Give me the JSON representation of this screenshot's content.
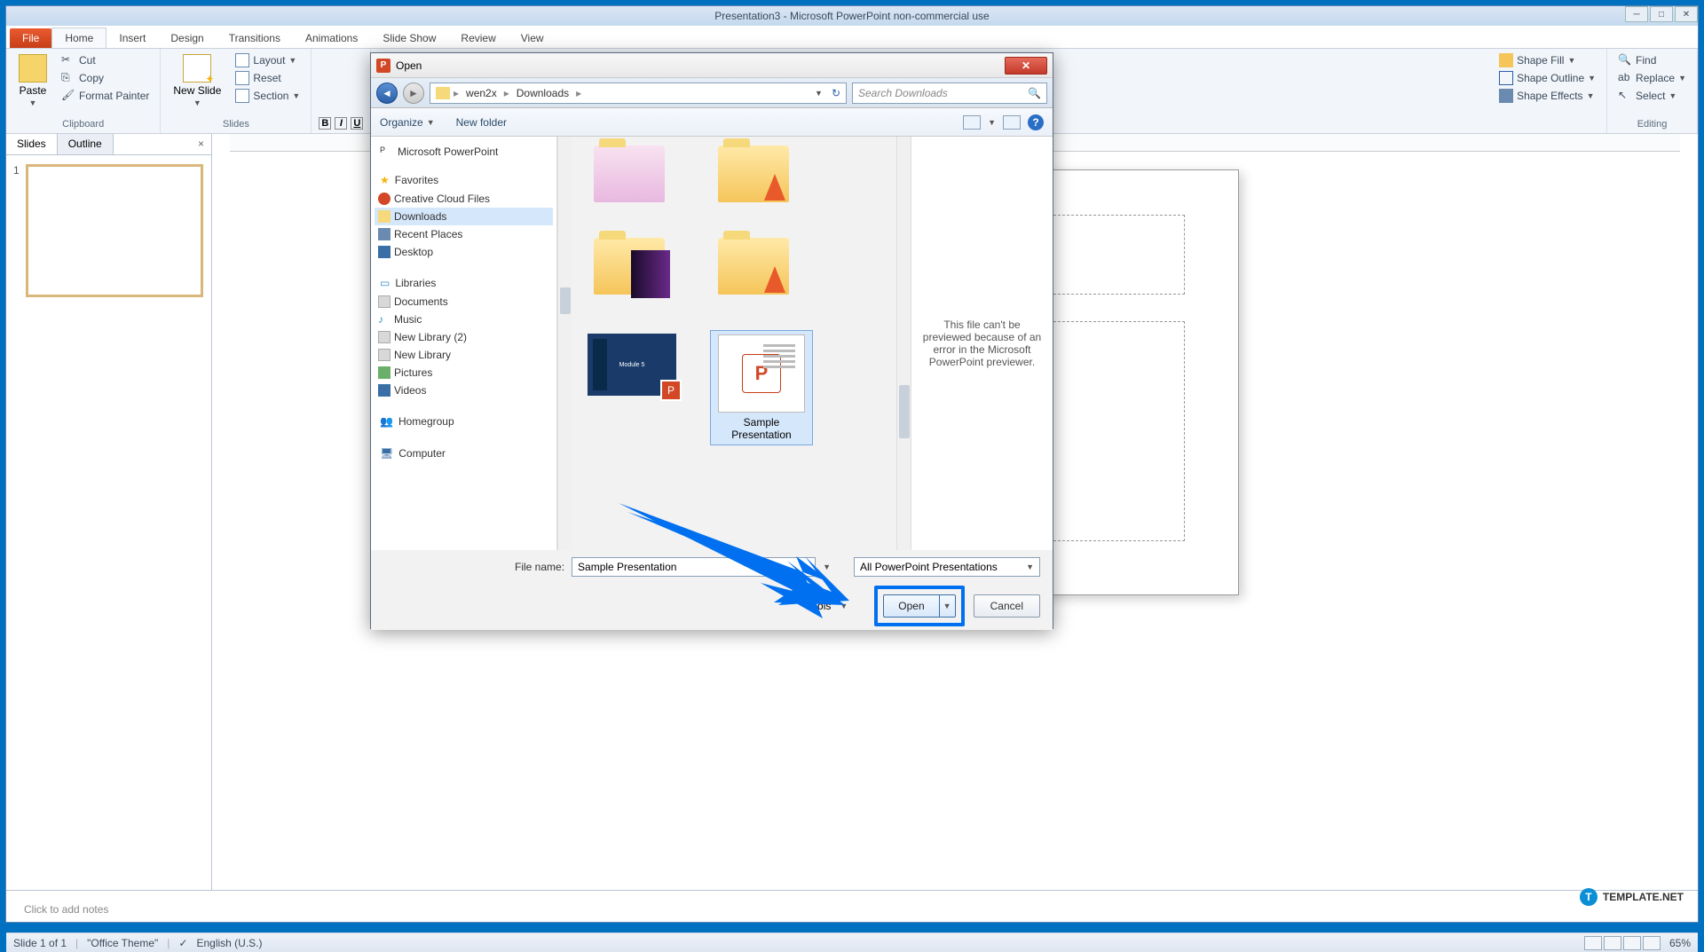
{
  "window": {
    "title": "Presentation3 - Microsoft PowerPoint non-commercial use"
  },
  "tabs": {
    "file": "File",
    "home": "Home",
    "insert": "Insert",
    "design": "Design",
    "transitions": "Transitions",
    "animations": "Animations",
    "slideshow": "Slide Show",
    "review": "Review",
    "view": "View"
  },
  "ribbon": {
    "clipboard": {
      "paste": "Paste",
      "cut": "Cut",
      "copy": "Copy",
      "format_painter": "Format Painter",
      "label": "Clipboard"
    },
    "slides": {
      "new_slide": "New Slide",
      "layout": "Layout",
      "reset": "Reset",
      "section": "Section",
      "label": "Slides"
    },
    "drawing": {
      "shape_fill": "Shape Fill",
      "shape_outline": "Shape Outline",
      "shape_effects": "Shape Effects"
    },
    "editing": {
      "find": "Find",
      "replace": "Replace",
      "select": "Select",
      "label": "Editing"
    }
  },
  "slide_panel": {
    "tab_slides": "Slides",
    "tab_outline": "Outline",
    "thumb_number": "1"
  },
  "notes": {
    "placeholder": "Click to add notes"
  },
  "status": {
    "slide_info": "Slide 1 of 1",
    "theme": "\"Office Theme\"",
    "lang": "English (U.S.)",
    "zoom": "65%"
  },
  "dialog": {
    "title": "Open",
    "breadcrumb": [
      "wen2x",
      "Downloads"
    ],
    "search_placeholder": "Search Downloads",
    "organize": "Organize",
    "new_folder": "New folder",
    "tree": {
      "app_folder": "Microsoft PowerPoint",
      "favorites": "Favorites",
      "fav_items": [
        "Creative Cloud Files",
        "Downloads",
        "Recent Places",
        "Desktop"
      ],
      "libraries": "Libraries",
      "lib_items": [
        "Documents",
        "Music",
        "New Library (2)",
        "New Library",
        "Pictures",
        "Videos"
      ],
      "homegroup": "Homegroup",
      "computer": "Computer"
    },
    "files": {
      "sample_name": "Sample Presentation"
    },
    "preview_msg": "This file can't be previewed because of an error in the Microsoft PowerPoint previewer.",
    "file_name_label": "File name:",
    "file_name_value": "Sample Presentation",
    "file_type": "All PowerPoint Presentations",
    "tools": "Tools",
    "open": "Open",
    "cancel": "Cancel"
  },
  "watermark": {
    "text": "TEMPLATE.NET"
  }
}
